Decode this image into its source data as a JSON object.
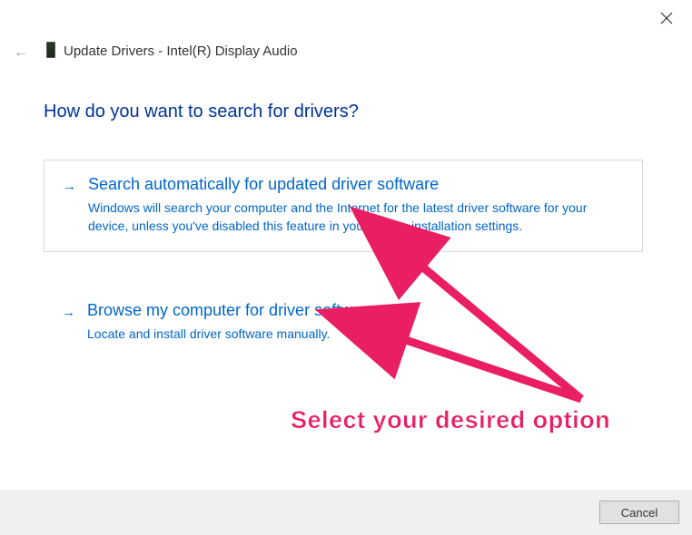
{
  "close_icon": "×",
  "back_arrow": "←",
  "title": "Update Drivers - Intel(R) Display Audio",
  "heading": "How do you want to search for drivers?",
  "options": [
    {
      "arrow": "→",
      "title": "Search automatically for updated driver software",
      "desc": "Windows will search your computer and the Internet for the latest driver software for your device, unless you've disabled this feature in your device installation settings."
    },
    {
      "arrow": "→",
      "title": "Browse my computer for driver software",
      "desc": "Locate and install driver software manually."
    }
  ],
  "annotation": "Select your desired option",
  "cancel_label": "Cancel"
}
